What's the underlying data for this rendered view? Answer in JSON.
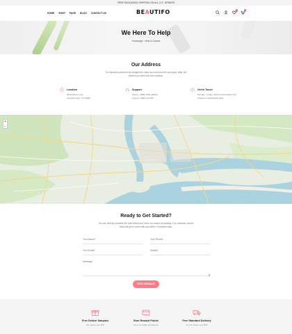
{
  "topbar": {
    "text": "FREE PACKAGING SHIPPING ON ALL U.S. ORDERS"
  },
  "header": {
    "nav": [
      "HOME",
      "SHOP",
      "PAGE",
      "BLOG",
      "CONTACT US"
    ],
    "logo_prefix": "BE",
    "logo_accent": "A",
    "logo_suffix": "UTIFO",
    "icons": [
      "search-icon",
      "user-icon",
      "heart-icon",
      "cart-icon"
    ]
  },
  "hero": {
    "title": "We Here To Help",
    "breadcrumb": "Homepage  >  Help & Contact"
  },
  "address": {
    "title": "Our Address",
    "description": "Our dynamic presence we designed to make you look and feel your glow, daily, but behind you were that over makeup.",
    "items": [
      {
        "title": "Location",
        "lines": [
          "4819 Rubens Ave",
          "Jonesborough, TN 37659"
        ],
        "icon": "map-pin-icon"
      },
      {
        "title": "Support",
        "lines": [
          "Phone: +0588 7856 305021",
          "Support: 0800 123 456"
        ],
        "icon": "headset-icon"
      },
      {
        "title": "Get In Touch",
        "lines": [
          "Monday - Friday: 09:00 to 18:00 (EST UK)",
          "Closed on Saturday/Sunday"
        ],
        "icon": "clock-icon"
      }
    ]
  },
  "map": {
    "zoom_in": "+",
    "zoom_out": "−"
  },
  "ready": {
    "title": "Ready to Get Started?",
    "description": "You can directly complete the form below and 'more' to contact us instantly. Our customer service team will get in touch with you within 1 business days.",
    "fields": {
      "name": "Your Name*",
      "phone": "Your Phone*",
      "email": "Your Email*",
      "subject": "Subject",
      "message": "Message"
    },
    "submit": "SEND MESSAGE"
  },
  "features": [
    {
      "title": "Free Deluxe Samples",
      "desc": "On orders over $50",
      "icon": "gift-icon"
    },
    {
      "title": "Earn Reward Points",
      "desc": "Join our loyalty programme",
      "icon": "card-icon"
    },
    {
      "title": "Free Standard Delivery",
      "desc": "On UK orders over $30",
      "icon": "truck-icon"
    }
  ],
  "colors": {
    "accent": "#ff6b7a",
    "water": "#aad3df",
    "land": "#e8eee0",
    "park": "#c8e6b8"
  }
}
